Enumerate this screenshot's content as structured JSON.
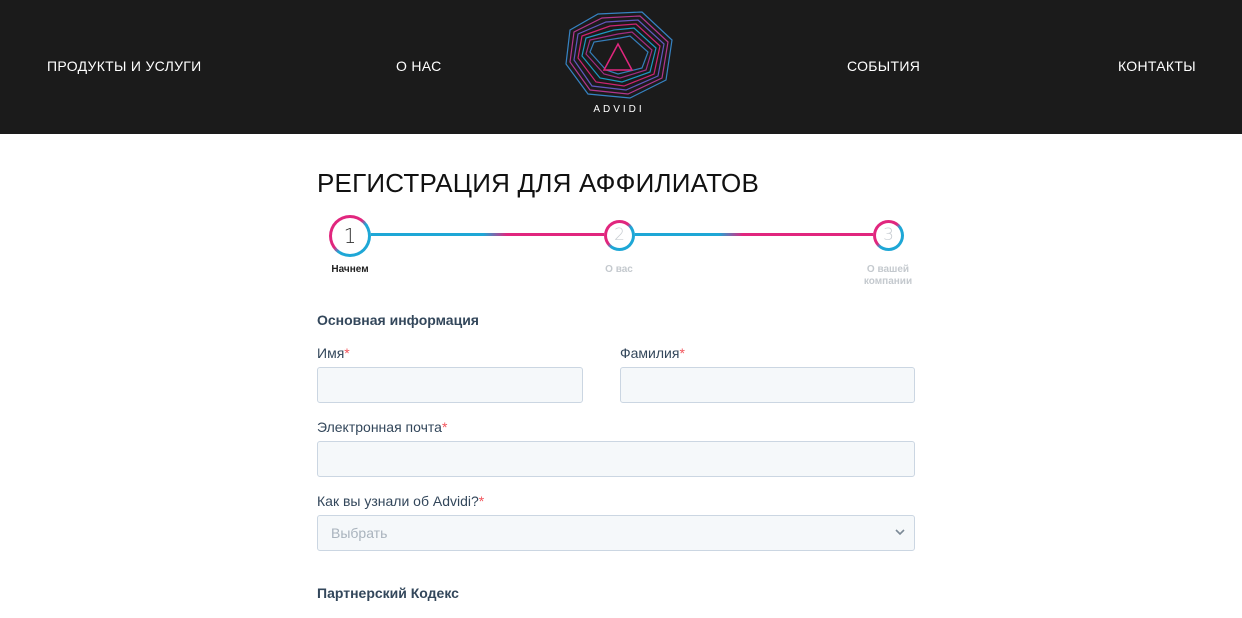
{
  "nav": {
    "products": "ПРОДУКТЫ И УСЛУГИ",
    "about": "О НАС",
    "events": "СОБЫТИЯ",
    "contacts": "КОНТАКТЫ"
  },
  "logo": {
    "text": "ADVIDI",
    "icon": "advidi-logo-icon"
  },
  "page": {
    "title": "РЕГИСТРАЦИЯ ДЛЯ АФФИЛИАТОВ"
  },
  "stepper": {
    "steps": [
      {
        "number": "1",
        "label": "Начнем",
        "active": true
      },
      {
        "number": "2",
        "label": "О вас",
        "active": false
      },
      {
        "number": "3",
        "label": "О вашей компании",
        "active": false
      }
    ]
  },
  "form": {
    "section_basic": "Основная информация",
    "first_name": {
      "label": "Имя",
      "value": ""
    },
    "last_name": {
      "label": "Фамилия",
      "value": ""
    },
    "email": {
      "label": "Электронная почта",
      "value": ""
    },
    "source": {
      "label": "Как вы узнали об Advidi?",
      "placeholder": "Выбрать"
    },
    "required_mark": "*",
    "section_partner": "Партнерский Кодекс"
  },
  "colors": {
    "header_bg": "#1b1b1b",
    "accent_cyan": "#1ea7d6",
    "accent_pink": "#e1267e",
    "field_bg": "#f5f8fa",
    "label_color": "#33475b",
    "required": "#f2545b"
  }
}
